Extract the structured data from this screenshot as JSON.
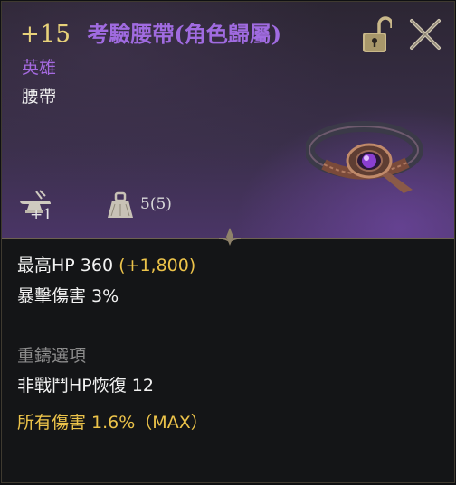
{
  "header": {
    "enhance_level": "+15",
    "item_name": "考驗腰帶(角色歸屬)",
    "grade": "英雄",
    "item_type": "腰帶",
    "trade_count": "+1",
    "weight": "5(5)"
  },
  "stats": {
    "hp_label": "最高HP 360",
    "hp_bonus": "(+1,800)",
    "crit_damage": "暴擊傷害 3%"
  },
  "reforge": {
    "title": "重鑄選項",
    "option1": "非戰鬥HP恢復 12",
    "option2": "所有傷害 1.6%（MAX）"
  },
  "icons": {
    "lock": "unlocked-padlock-icon",
    "close": "close-x-icon",
    "anvil": "anvil-icon",
    "weight": "weight-icon",
    "item": "belt-item-icon"
  },
  "colors": {
    "grade_purple": "#a56ae0",
    "enhance_gold": "#e8d27a",
    "bonus_gold": "#ecc34a",
    "section_grey": "#8c8c8c"
  }
}
